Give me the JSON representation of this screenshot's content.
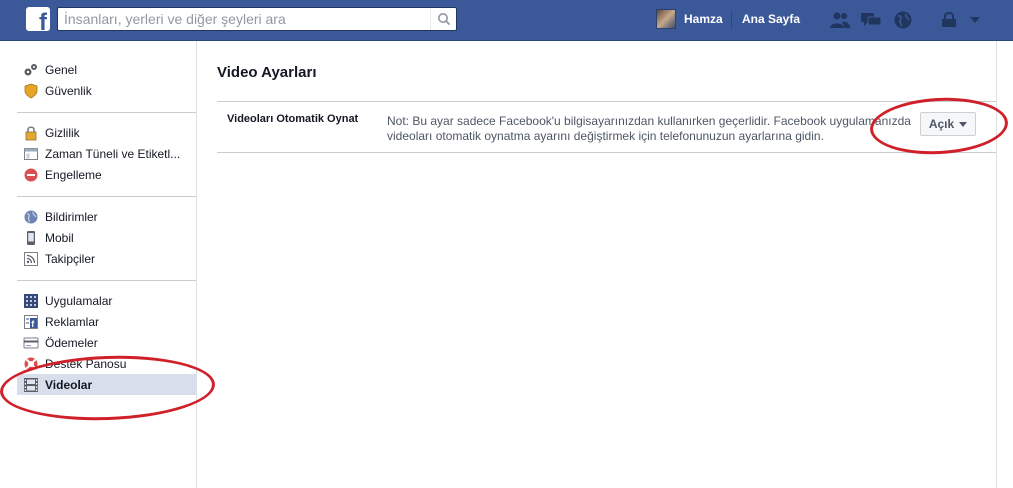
{
  "topbar": {
    "logo": "f",
    "search_placeholder": "İnsanları, yerleri ve diğer şeyleri ara",
    "search_icon": "search-icon",
    "user_name": "Hamza",
    "home_label": "Ana Sayfa",
    "icons": [
      "friend-requests-icon",
      "messages-icon",
      "notifications-icon",
      "privacy-shortcuts-icon",
      "account-menu-chevron-icon"
    ]
  },
  "sidebar": {
    "groups": [
      [
        {
          "label": "Genel",
          "icon": "gears-icon"
        },
        {
          "label": "Güvenlik",
          "icon": "shield-icon"
        }
      ],
      [
        {
          "label": "Gizlilik",
          "icon": "lock-icon"
        },
        {
          "label": "Zaman Tüneli ve Etiketl...",
          "icon": "timeline-icon"
        },
        {
          "label": "Engelleme",
          "icon": "block-icon"
        }
      ],
      [
        {
          "label": "Bildirimler",
          "icon": "globe-icon"
        },
        {
          "label": "Mobil",
          "icon": "phone-icon"
        },
        {
          "label": "Takipçiler",
          "icon": "rss-icon"
        }
      ],
      [
        {
          "label": "Uygulamalar",
          "icon": "apps-icon"
        },
        {
          "label": "Reklamlar",
          "icon": "ads-icon"
        },
        {
          "label": "Ödemeler",
          "icon": "credit-card-icon"
        },
        {
          "label": "Destek Panosu",
          "icon": "lifebuoy-icon"
        },
        {
          "label": "Videolar",
          "icon": "film-icon",
          "active": true
        }
      ]
    ]
  },
  "main": {
    "title": "Video Ayarları",
    "setting": {
      "label": "Videoları Otomatik Oynat",
      "description": "Not: Bu ayar sadece Facebook'u bilgisayarınızdan kullanırken geçerlidir. Facebook uygulamanızda videoları otomatik oynatma ayarını değiştirmek için telefonunuzun ayarlarına gidin.",
      "value": "Açık"
    }
  },
  "colors": {
    "brand_blue": "#3b5998",
    "annotation_red": "#d0202a",
    "active_item_bg": "#d8dfea"
  }
}
